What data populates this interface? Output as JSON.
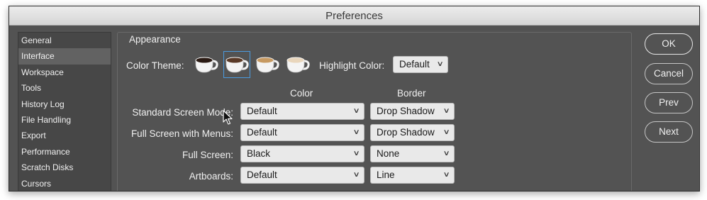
{
  "window": {
    "title": "Preferences"
  },
  "sidebar": {
    "items": [
      {
        "label": "General",
        "selected": false
      },
      {
        "label": "Interface",
        "selected": true
      },
      {
        "label": "Workspace",
        "selected": false
      },
      {
        "label": "Tools",
        "selected": false
      },
      {
        "label": "History Log",
        "selected": false
      },
      {
        "label": "File Handling",
        "selected": false
      },
      {
        "label": "Export",
        "selected": false
      },
      {
        "label": "Performance",
        "selected": false
      },
      {
        "label": "Scratch Disks",
        "selected": false
      },
      {
        "label": "Cursors",
        "selected": false
      }
    ]
  },
  "appearance": {
    "title": "Appearance",
    "color_theme_label": "Color Theme:",
    "themes": [
      {
        "icon": "coffee-cup-darkest-icon",
        "coffee": "#2b1b14",
        "selected": false
      },
      {
        "icon": "coffee-cup-dark-icon",
        "coffee": "#5a3a28",
        "selected": true
      },
      {
        "icon": "coffee-cup-medium-icon",
        "coffee": "#c79a62",
        "selected": false
      },
      {
        "icon": "coffee-cup-light-icon",
        "coffee": "#e9d6bc",
        "selected": false
      }
    ],
    "highlight_label": "Highlight Color:",
    "highlight_value": "Default",
    "col_color": "Color",
    "col_border": "Border",
    "rows": [
      {
        "label": "Standard Screen Mode:",
        "color": "Default",
        "border": "Drop Shadow"
      },
      {
        "label": "Full Screen with Menus:",
        "color": "Default",
        "border": "Drop Shadow"
      },
      {
        "label": "Full Screen:",
        "color": "Black",
        "border": "None"
      },
      {
        "label": "Artboards:",
        "color": "Default",
        "border": "Line"
      }
    ]
  },
  "buttons": {
    "ok": "OK",
    "cancel": "Cancel",
    "prev": "Prev",
    "next": "Next"
  },
  "colors": {
    "selection_outline": "#4b9be0",
    "panel_bg": "#535353"
  }
}
